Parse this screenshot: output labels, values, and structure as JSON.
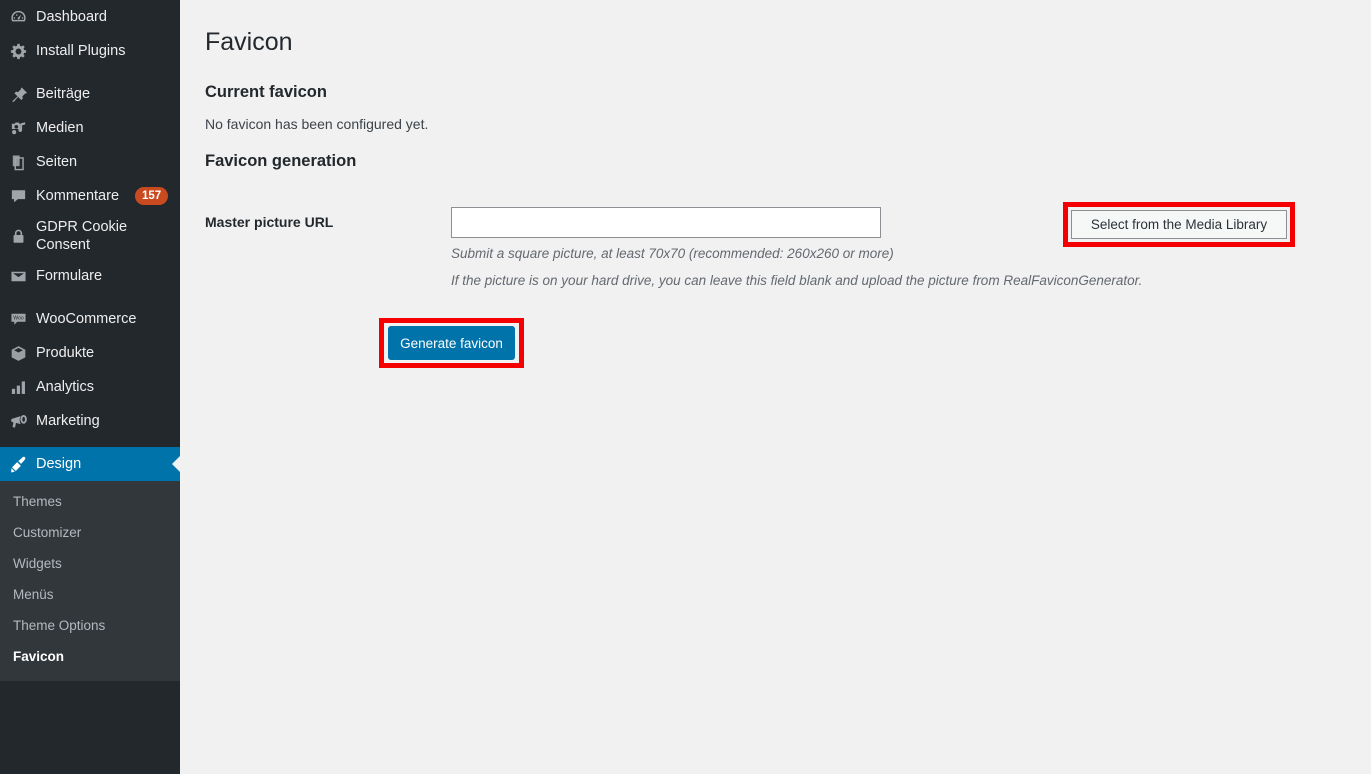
{
  "sidebar": {
    "groups": [
      {
        "items": [
          {
            "label": "Dashboard",
            "icon": "dashboard-gauge-icon",
            "badge": null
          },
          {
            "label": "Install Plugins",
            "icon": "gear-icon",
            "badge": null
          }
        ]
      },
      {
        "items": [
          {
            "label": "Beiträge",
            "icon": "pushpin-icon",
            "badge": null
          },
          {
            "label": "Medien",
            "icon": "media-camera-music-icon",
            "badge": null
          },
          {
            "label": "Seiten",
            "icon": "pages-icon",
            "badge": null
          },
          {
            "label": "Kommentare",
            "icon": "comment-bubble-icon",
            "badge": "157"
          },
          {
            "label": "GDPR Cookie Consent",
            "icon": "lock-icon",
            "badge": null
          },
          {
            "label": "Formulare",
            "icon": "envelope-icon",
            "badge": null
          }
        ]
      },
      {
        "items": [
          {
            "label": "WooCommerce",
            "icon": "woo-bubble-icon",
            "badge": null
          },
          {
            "label": "Produkte",
            "icon": "box-icon",
            "badge": null
          },
          {
            "label": "Analytics",
            "icon": "bar-chart-icon",
            "badge": null
          },
          {
            "label": "Marketing",
            "icon": "megaphone-icon",
            "badge": null
          }
        ]
      }
    ],
    "current_item": {
      "label": "Design",
      "icon": "paintbrush-icon"
    },
    "submenu": [
      {
        "label": "Themes",
        "current": false
      },
      {
        "label": "Customizer",
        "current": false
      },
      {
        "label": "Widgets",
        "current": false
      },
      {
        "label": "Menüs",
        "current": false
      },
      {
        "label": "Theme Options",
        "current": false
      },
      {
        "label": "Favicon",
        "current": true
      }
    ]
  },
  "main": {
    "page_title": "Favicon",
    "current_favicon": {
      "heading": "Current favicon",
      "message": "No favicon has been configured yet."
    },
    "favicon_generation": {
      "heading": "Favicon generation",
      "field_label": "Master picture URL",
      "field_value": "",
      "field_placeholder": "",
      "media_button_label": "Select from the Media Library",
      "description_line_1": "Submit a square picture, at least 70x70 (recommended: 260x260 or more)",
      "description_line_2": "If the picture is on your hard drive, you can leave this field blank and upload the picture from RealFaviconGenerator.",
      "generate_button_label": "Generate favicon"
    }
  },
  "colors": {
    "sidebar_bg": "#23282d",
    "submenu_bg": "#32373c",
    "accent_blue": "#0073aa",
    "badge_orange": "#ca4a1f",
    "highlight_red": "#f40000",
    "content_bg": "#f1f1f1"
  }
}
